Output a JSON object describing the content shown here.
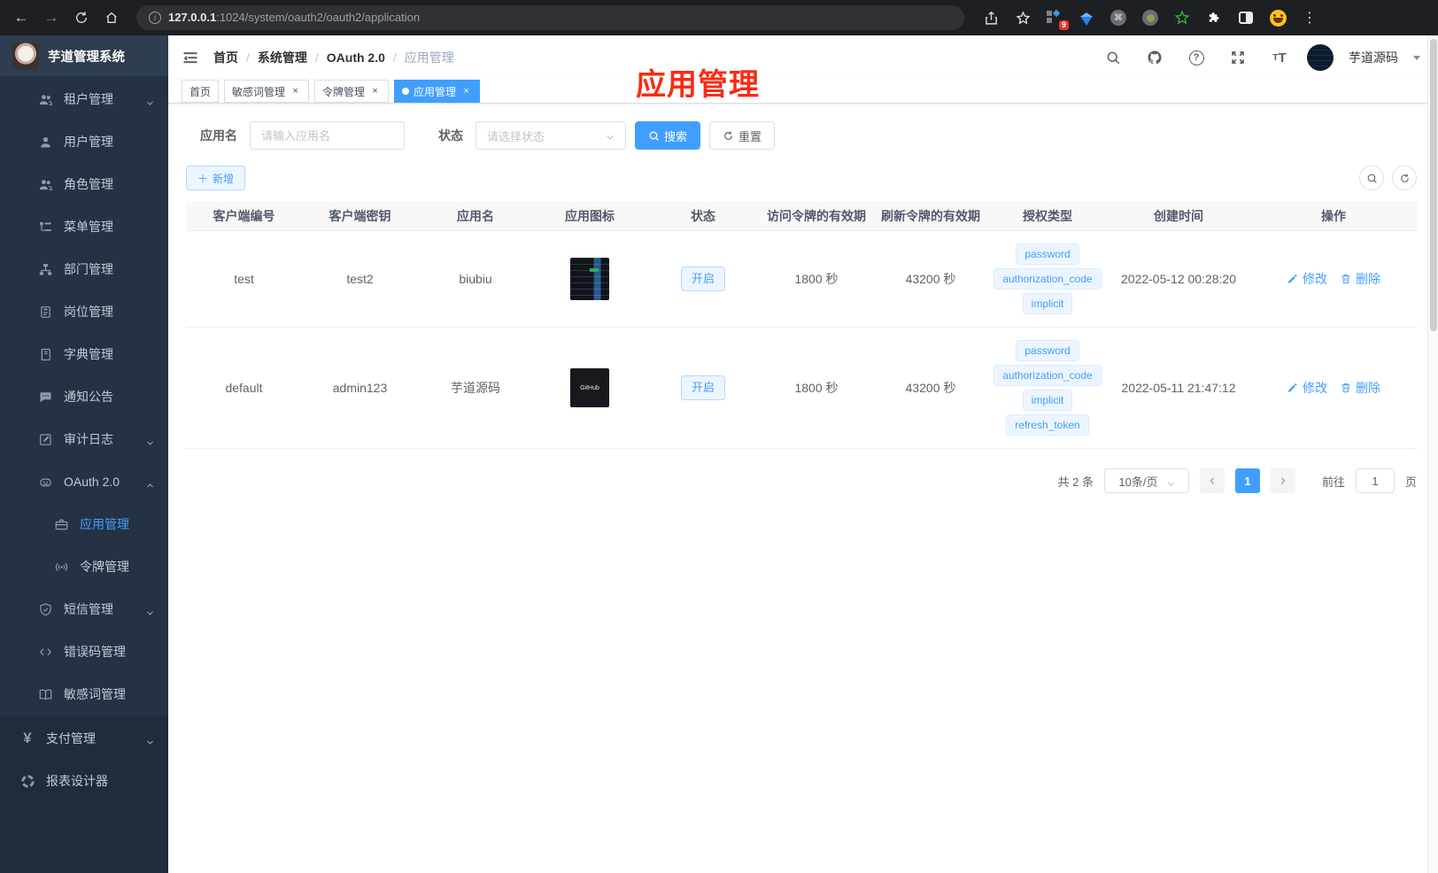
{
  "browser": {
    "url_host": "127.0.0.1",
    "url_rest": ":1024/system/oauth2/oauth2/application",
    "extension_badge": "9"
  },
  "sidebar": {
    "title": "芋道管理系统",
    "items": [
      {
        "label": "租户管理",
        "icon": "tenant-users-icon",
        "chevron": "down"
      },
      {
        "label": "用户管理",
        "icon": "user-icon"
      },
      {
        "label": "角色管理",
        "icon": "role-users-icon"
      },
      {
        "label": "菜单管理",
        "icon": "menu-tree-icon"
      },
      {
        "label": "部门管理",
        "icon": "sitemap-icon"
      },
      {
        "label": "岗位管理",
        "icon": "post-badge-icon"
      },
      {
        "label": "字典管理",
        "icon": "dictionary-icon"
      },
      {
        "label": "通知公告",
        "icon": "notice-bubble-icon"
      },
      {
        "label": "审计日志",
        "icon": "audit-log-icon",
        "chevron": "down"
      },
      {
        "label": "OAuth 2.0",
        "icon": "robot-icon",
        "chevron": "up"
      },
      {
        "label": "应用管理",
        "icon": "briefcase-icon",
        "child": true,
        "active": true
      },
      {
        "label": "令牌管理",
        "icon": "signal-icon",
        "child": true
      },
      {
        "label": "短信管理",
        "icon": "shield-icon",
        "chevron": "down"
      },
      {
        "label": "错误码管理",
        "icon": "code-icon"
      },
      {
        "label": "敏感词管理",
        "icon": "open-book-icon"
      }
    ],
    "bottom_items": [
      {
        "label": "支付管理",
        "icon": "yen-icon",
        "chevron": "down"
      },
      {
        "label": "报表设计器",
        "icon": "report-ring-icon"
      }
    ]
  },
  "navbar": {
    "breadcrumb": [
      "首页",
      "系统管理",
      "OAuth 2.0",
      "应用管理"
    ],
    "username": "芋道源码"
  },
  "tags": [
    {
      "label": "首页",
      "closable": false,
      "active": false
    },
    {
      "label": "敏感词管理",
      "closable": true,
      "active": false
    },
    {
      "label": "令牌管理",
      "closable": true,
      "active": false
    },
    {
      "label": "应用管理",
      "closable": true,
      "active": true
    }
  ],
  "annotation": "应用管理",
  "filters": {
    "name_label": "应用名",
    "name_placeholder": "请输入应用名",
    "status_label": "状态",
    "status_placeholder": "请选择状态",
    "search_label": "搜索",
    "reset_label": "重置",
    "add_label": "新增"
  },
  "table": {
    "columns": [
      "客户端编号",
      "客户端密钥",
      "应用名",
      "应用图标",
      "状态",
      "访问令牌的有效期",
      "刷新令牌的有效期",
      "授权类型",
      "创建时间",
      "操作"
    ],
    "rows": [
      {
        "client_id": "test",
        "client_secret": "test2",
        "name": "biubiu",
        "icon": "screenshot",
        "icon_text": "",
        "status": "开启",
        "access_ttl": "1800 秒",
        "refresh_ttl": "43200 秒",
        "grants": [
          "password",
          "authorization_code",
          "implicit"
        ],
        "created": "2022-05-12 00:28:20"
      },
      {
        "client_id": "default",
        "client_secret": "admin123",
        "name": "芋道源码",
        "icon": "github",
        "icon_text": "GitHub",
        "status": "开启",
        "access_ttl": "1800 秒",
        "refresh_ttl": "43200 秒",
        "grants": [
          "password",
          "authorization_code",
          "implicit",
          "refresh_token"
        ],
        "created": "2022-05-11 21:47:12"
      }
    ],
    "edit_label": "修改",
    "delete_label": "删除"
  },
  "pagination": {
    "total": "共 2 条",
    "per_page": "10条/页",
    "current": "1",
    "goto_prefix": "前往",
    "goto_value": "1",
    "goto_suffix": "页"
  },
  "colors": {
    "accent": "#409eff",
    "annotation_red": "#fb2a12",
    "sidebar_bg": "#253244",
    "tag_bg": "#ecf5ff"
  }
}
